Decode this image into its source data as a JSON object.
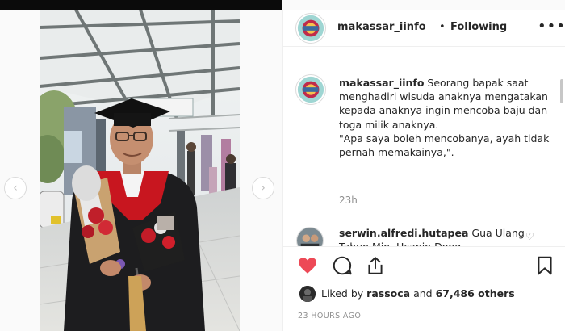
{
  "post": {
    "username": "makassar_iinfo",
    "separator": "•",
    "follow_label": "Following",
    "more_label": "•••"
  },
  "caption": {
    "username": "makassar_iinfo",
    "text": "Seorang bapak saat menghadiri wisuda anaknya mengatakan kepada anaknya ingin mencoba baju dan toga milik anaknya.",
    "quote": "\"Apa saya boleh mencobanya, ayah tidak pernah memakainya,\".",
    "time": "23h"
  },
  "comment": {
    "username": "serwin.alfredi.hutapea",
    "text": "Gua Ulang Tahun Min..Ucapin Dong"
  },
  "likes": {
    "prefix": "Liked by",
    "user": "rassoca",
    "conj": "and",
    "count": "67,486 others"
  },
  "timestamp": "23 HOURS AGO",
  "nav": {
    "prev_icon": "chevron-left-icon",
    "next_icon": "chevron-right-icon"
  },
  "colors": {
    "like_red": "#ed4956",
    "border": "#efefef",
    "muted": "#8e8e8e"
  }
}
